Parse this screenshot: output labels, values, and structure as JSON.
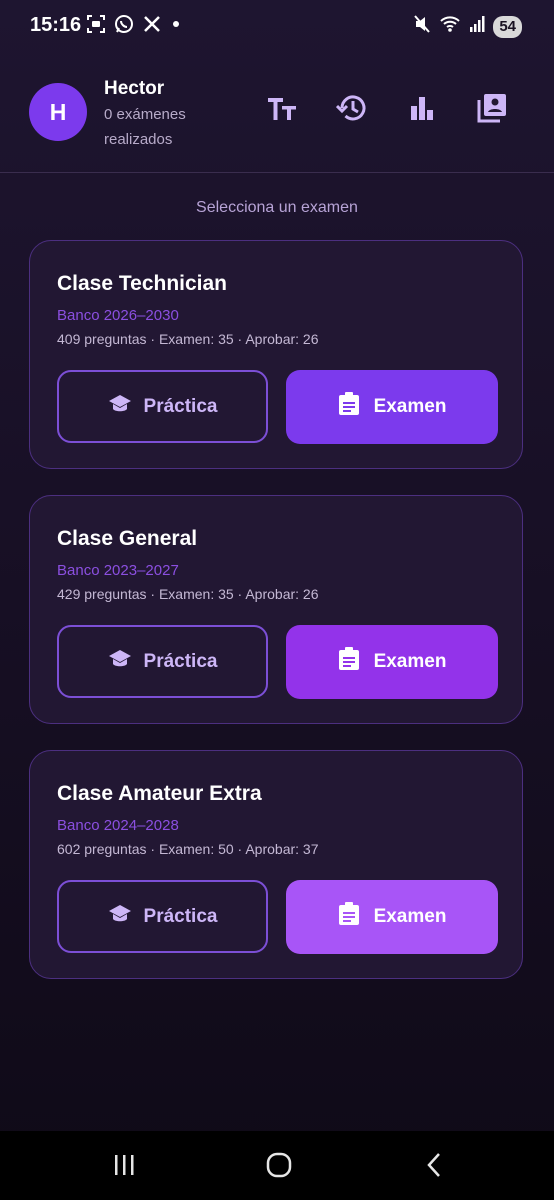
{
  "status_bar": {
    "time": "15:16",
    "battery": "54",
    "left_icons": [
      "screenshot-icon",
      "whatsapp-icon",
      "x-icon",
      "dot-icon"
    ],
    "right_icons": [
      "mute-icon",
      "wifi-icon",
      "signal-icon"
    ]
  },
  "header": {
    "avatar_initial": "H",
    "user_name": "Hector",
    "user_sub": "0 exámenes realizados",
    "actions": [
      "text-size-icon",
      "history-icon",
      "stats-icon",
      "library-icon"
    ]
  },
  "main": {
    "prompt": "Selecciona un examen",
    "cards": [
      {
        "title": "Clase Technician",
        "bank": "Banco 2026–2030",
        "meta": "409 preguntas · Examen: 35 · Aprobar: 26",
        "practice_label": "Práctica",
        "exam_label": "Examen",
        "exam_color": "#7c3aed"
      },
      {
        "title": "Clase General",
        "bank": "Banco 2023–2027",
        "meta": "429 preguntas · Examen: 35 · Aprobar: 26",
        "practice_label": "Práctica",
        "exam_label": "Examen",
        "exam_color": "#9333ea"
      },
      {
        "title": "Clase Amateur Extra",
        "bank": "Banco 2024–2028",
        "meta": "602 preguntas · Examen: 50 · Aprobar: 37",
        "practice_label": "Práctica",
        "exam_label": "Examen",
        "exam_color": "#a855f7"
      }
    ]
  },
  "nav_bar": {
    "buttons": [
      "recents-icon",
      "home-icon",
      "back-icon"
    ]
  },
  "colors": {
    "accent": "#7c3aed",
    "bank_text": "#8b4fe0",
    "card_border": "#4c2f80",
    "card_bg": "#221733"
  }
}
